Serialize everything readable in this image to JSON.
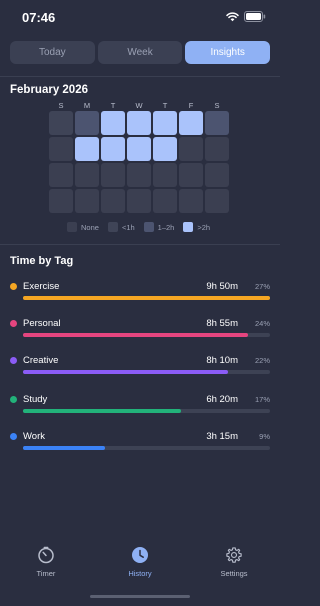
{
  "status_bar": {
    "time": "07:46"
  },
  "segmented_control": {
    "tabs": [
      {
        "label": "Today",
        "active": false
      },
      {
        "label": "Week",
        "active": false
      },
      {
        "label": "Insights",
        "active": true
      }
    ]
  },
  "calendar": {
    "month_title": "February 2026",
    "weekdays": [
      "S",
      "M",
      "T",
      "W",
      "T",
      "F",
      "S"
    ],
    "levels": [
      [
        1,
        2,
        3,
        3,
        3,
        3,
        2
      ],
      [
        0,
        3,
        3,
        3,
        3,
        0,
        0
      ],
      [
        0,
        0,
        0,
        0,
        0,
        0,
        0
      ],
      [
        0,
        0,
        0,
        0,
        0,
        0,
        0
      ]
    ],
    "legend": [
      {
        "label": "None",
        "color": "#3b3f51"
      },
      {
        "label": "<1h",
        "color": "#3f4457"
      },
      {
        "label": "1–2h",
        "color": "#4c5470"
      },
      {
        "label": ">2h",
        "color": "#aac3fb"
      }
    ]
  },
  "time_by_tag": {
    "title": "Time by Tag",
    "tags": [
      {
        "name": "Exercise",
        "time": "9h 50m",
        "percent": "27%",
        "fill": 1.0,
        "color": "#f5a623"
      },
      {
        "name": "Personal",
        "time": "8h 55m",
        "percent": "24%",
        "fill": 0.91,
        "color": "#e5457f"
      },
      {
        "name": "Creative",
        "time": "8h 10m",
        "percent": "22%",
        "fill": 0.83,
        "color": "#8b5cf6"
      },
      {
        "name": "Study",
        "time": "6h 20m",
        "percent": "17%",
        "fill": 0.64,
        "color": "#22b27a"
      },
      {
        "name": "Work",
        "time": "3h 15m",
        "percent": "9%",
        "fill": 0.33,
        "color": "#3b82f6"
      }
    ]
  },
  "tab_bar": {
    "items": [
      {
        "label": "Timer",
        "icon": "timer-icon",
        "active": false
      },
      {
        "label": "History",
        "icon": "clock-icon",
        "active": true
      },
      {
        "label": "Settings",
        "icon": "gear-icon",
        "active": false
      }
    ]
  }
}
